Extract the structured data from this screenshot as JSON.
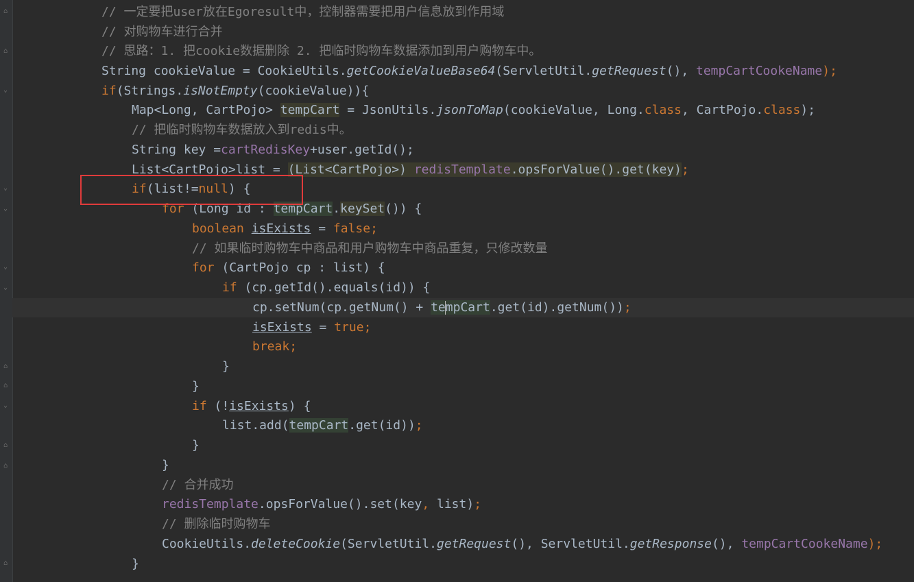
{
  "editor": {
    "line1": [
      "// 一定要把user放在Egoresult中，控制器需要把用户信息放到作用域"
    ],
    "line2": [
      "// 对购物车进行合并"
    ],
    "line3": [
      "// 思路：1. 把cookie数据删除 2. 把临时购物车数据添加到用户购物车中。"
    ],
    "line4": [
      "String cookieValue = CookieUtils.",
      "getCookieValueBase64",
      "(ServletUtil.",
      "getRequest",
      "(), ",
      "tempCartCookeName",
      ");"
    ],
    "line5": [
      "if",
      "(Strings.",
      "isNotEmpty",
      "(cookieValue)){"
    ],
    "line6": [
      "Map<Long, CartPojo> ",
      "tempCart",
      " = JsonUtils.",
      "jsonToMap",
      "(cookieValue, Long.",
      "class",
      ", CartPojo.",
      "class",
      ");"
    ],
    "line7": [
      "// 把临时购物车数据放入到redis中。"
    ],
    "line8": [
      "String key =",
      "cartRedisKey",
      "+user.getId();"
    ],
    "line9": [
      "List<CartPojo>list = ",
      "(List<CartPojo>) ",
      "redisTemplate",
      ".opsForValue().get(key)",
      ";"
    ],
    "line10": [
      "if",
      "(list!=",
      "null",
      ") {"
    ],
    "line11": [
      "for",
      " (Long id : ",
      "tempCart",
      ".",
      "keySet",
      "()) {"
    ],
    "line12": [
      "boolean ",
      "isExists",
      " = ",
      "false",
      ";"
    ],
    "line13": [
      "// 如果临时购物车中商品和用户购物车中商品重复，只修改数量"
    ],
    "line14": [
      "for",
      " (CartPojo cp : list) {"
    ],
    "line15": [
      "if",
      " (cp.getId().equals(id)) {"
    ],
    "line16": [
      "cp.setNum(cp.getNum() + ",
      "te",
      "mpCart",
      ".get(id).getNum())",
      ";"
    ],
    "line17": [
      "isExists",
      " = ",
      "true",
      ";"
    ],
    "line18": [
      "break",
      ";"
    ],
    "line19": [
      "}"
    ],
    "line20": [
      "}"
    ],
    "line21": [
      "if",
      " (!",
      "isExists",
      ") {"
    ],
    "line22": [
      "list.add(",
      "tempCart",
      ".get(id))",
      ";"
    ],
    "line23": [
      "}"
    ],
    "line24": [
      "}"
    ],
    "line25": [
      "// 合并成功"
    ],
    "line26": [
      "redisTemplate",
      ".opsForValue().set(key",
      ", ",
      "list)",
      ";"
    ],
    "line27": [
      "// 删除临时购物车"
    ],
    "line28": [
      "CookieUtils.",
      "deleteCookie",
      "(ServletUtil.",
      "getRequest",
      "(), ServletUtil.",
      "getResponse",
      "(), ",
      "tempCartCookeName",
      ");"
    ],
    "line29": [
      "}"
    ]
  },
  "colors": {
    "background": "#2b2b2b",
    "keyword": "#cc7832",
    "comment": "#808080",
    "field": "#9876aa",
    "text": "#a9b7c6",
    "annotation_box": "#e03b3b"
  }
}
